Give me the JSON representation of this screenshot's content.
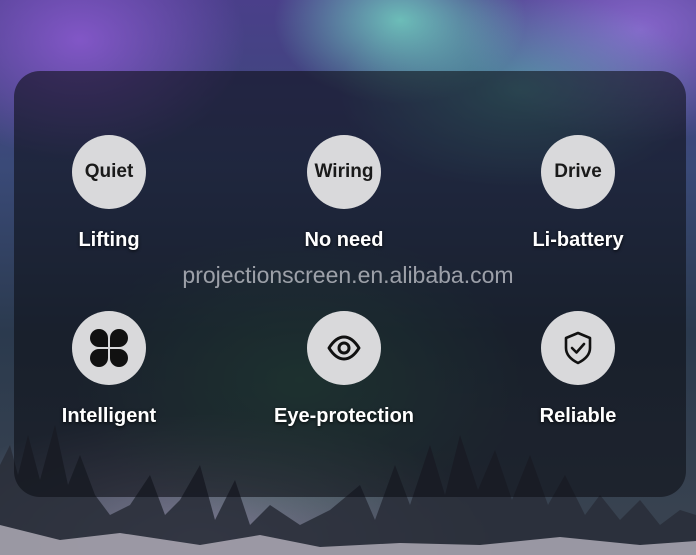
{
  "features": [
    {
      "circle_text": "Quiet",
      "label": "Lifting"
    },
    {
      "circle_text": "Wiring",
      "label": "No need"
    },
    {
      "circle_text": "Drive",
      "label": "Li-battery"
    },
    {
      "icon": "four-petal-grid-icon",
      "label": "Intelligent"
    },
    {
      "icon": "eye-icon",
      "label": "Eye-protection"
    },
    {
      "icon": "shield-check-icon",
      "label": "Reliable"
    }
  ],
  "watermark": "projectionscreen.en.alibaba.com",
  "colors": {
    "circle": "#d9d9db",
    "panel": "rgba(12,14,20,0.58)",
    "label": "#ffffff"
  }
}
